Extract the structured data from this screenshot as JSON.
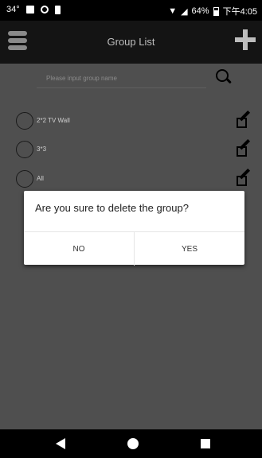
{
  "status_bar": {
    "temperature": "34°",
    "battery_percent": "64%",
    "time": "下午4:05"
  },
  "app_bar": {
    "title": "Group List",
    "menu_icon": "hamburger-icon",
    "add_icon": "plus-icon"
  },
  "search": {
    "placeholder": "Please input group name",
    "value": "",
    "icon": "magnifier-icon"
  },
  "groups": [
    {
      "label": "2*2 TV Wall"
    },
    {
      "label": "3*3"
    },
    {
      "label": "All"
    }
  ],
  "dialog": {
    "message": "Are you sure to delete the group?",
    "no_label": "NO",
    "yes_label": "YES"
  },
  "colors": {
    "content_background": "#4f4f4f",
    "app_bar_background": "#141414",
    "dialog_background": "#ffffff"
  }
}
